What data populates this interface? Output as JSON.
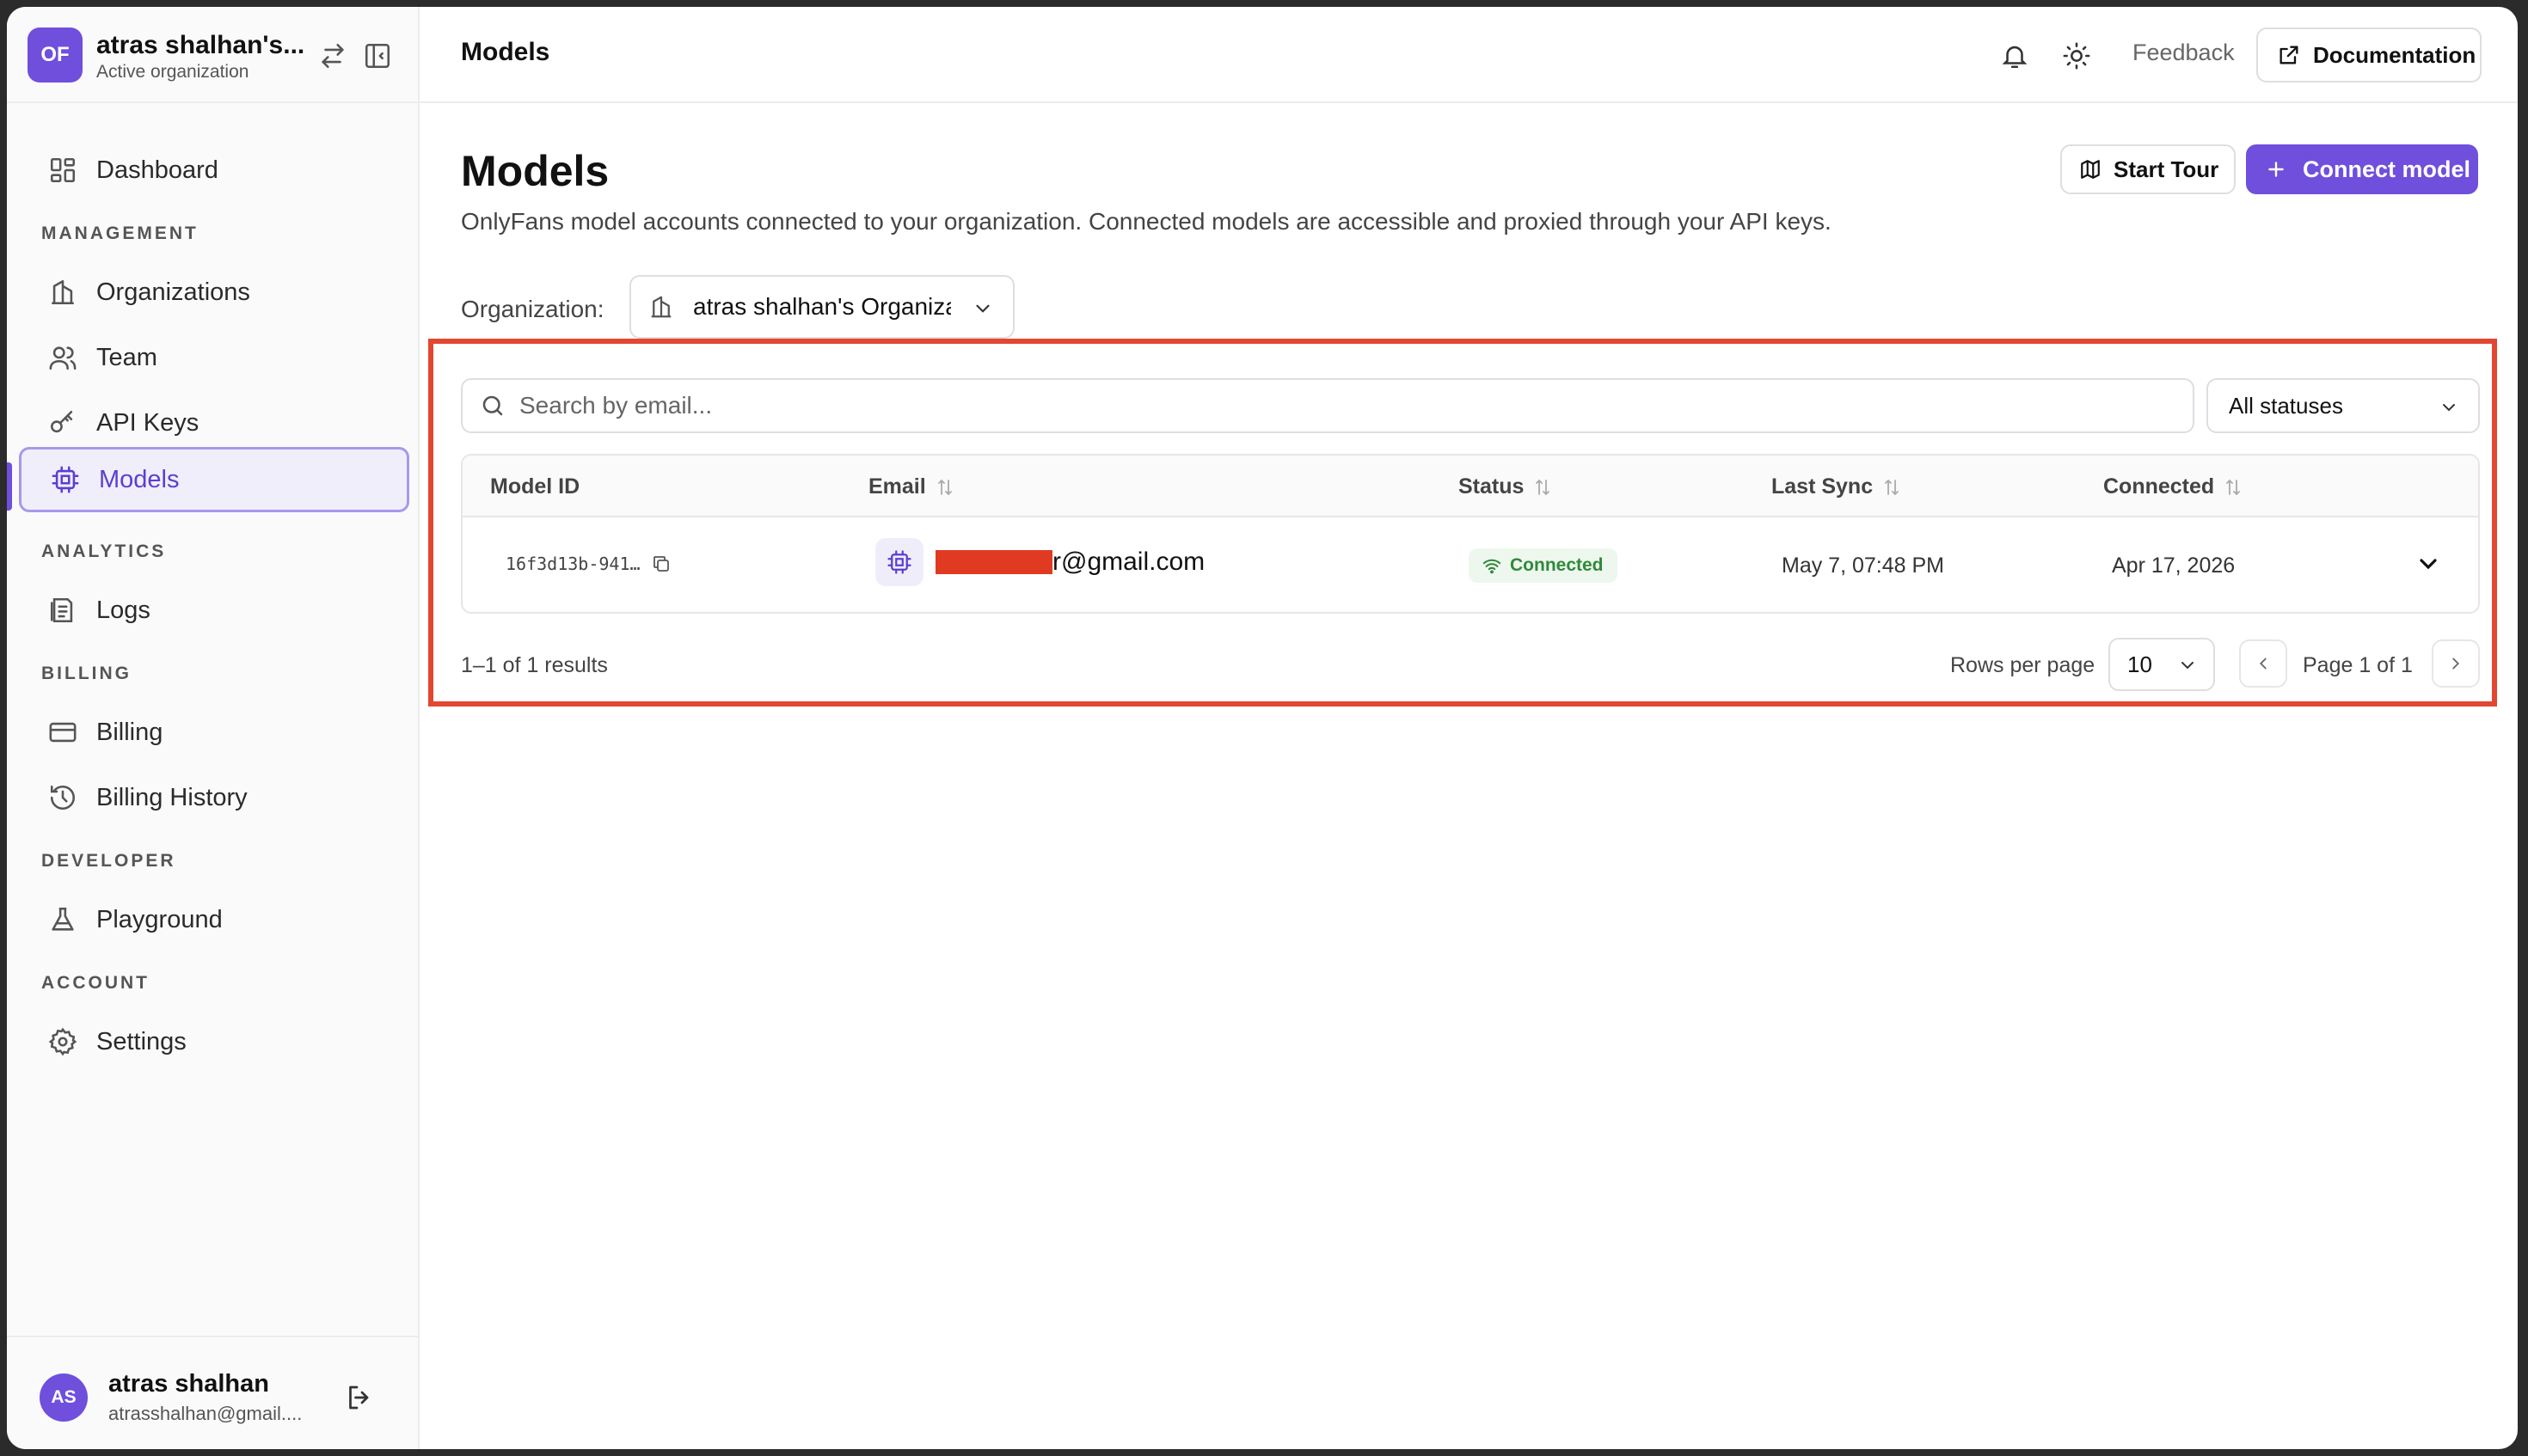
{
  "org": {
    "avatar_initials": "OF",
    "name": "atras shalhan's...",
    "subtitle": "Active organization"
  },
  "sidebar": {
    "dashboard": "Dashboard",
    "sections": {
      "management": "MANAGEMENT",
      "analytics": "ANALYTICS",
      "billing": "BILLING",
      "developer": "DEVELOPER",
      "account": "ACCOUNT"
    },
    "items": {
      "organizations": "Organizations",
      "team": "Team",
      "api_keys": "API Keys",
      "models": "Models",
      "logs": "Logs",
      "billing": "Billing",
      "billing_history": "Billing History",
      "playground": "Playground",
      "settings": "Settings"
    },
    "active_item": "Models"
  },
  "user": {
    "initials": "AS",
    "name": "atras shalhan",
    "email": "atrasshalhan@gmail...."
  },
  "topbar": {
    "title": "Models",
    "feedback": "Feedback",
    "documentation": "Documentation"
  },
  "main": {
    "title": "Models",
    "description": "OnlyFans model accounts connected to your organization. Connected models are accessible and proxied through your API keys.",
    "start_tour": "Start Tour",
    "connect_model": "Connect model",
    "org_label": "Organization:",
    "org_selected": "atras shalhan's Organization"
  },
  "filters": {
    "search_placeholder": "Search by email...",
    "status_selected": "All statuses"
  },
  "table": {
    "columns": {
      "model_id": "Model ID",
      "email": "Email",
      "status": "Status",
      "last_sync": "Last Sync",
      "connected": "Connected"
    },
    "rows": [
      {
        "model_id": "16f3d13b-941…",
        "email_visible": "r@gmail.com",
        "status": "Connected",
        "last_sync": "May 7, 07:48 PM",
        "connected": "Apr 17, 2026"
      }
    ]
  },
  "pagination": {
    "results": "1–1 of 1 results",
    "rows_per_page_label": "Rows per page",
    "rows_per_page": "10",
    "page_info": "Page 1 of 1"
  },
  "colors": {
    "accent": "#6f4fdc",
    "highlight": "#e34631",
    "redaction": "#e03b22",
    "status_connected": "#2e8a3a"
  }
}
